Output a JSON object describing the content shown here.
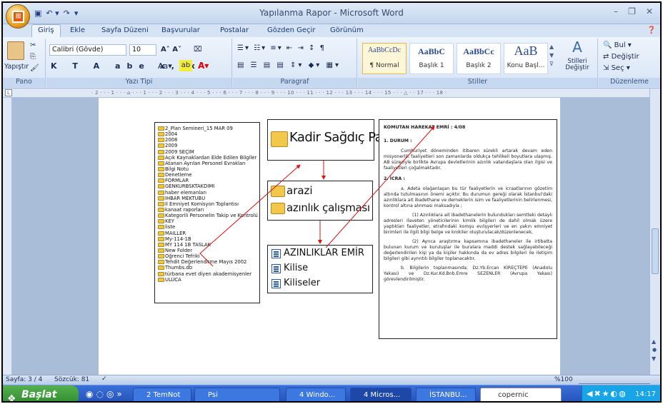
{
  "window": {
    "title": "Yapılanma Rapor - Microsoft Word"
  },
  "tabs": [
    "Giriş",
    "Ekle",
    "Sayfa Düzeni",
    "Başvurular",
    "Postalar",
    "Gözden Geçir",
    "Görünüm"
  ],
  "ribbon": {
    "clipboard": {
      "paste": "Yapıştır",
      "label": "Pano"
    },
    "font": {
      "name": "Calibri (Gövde)",
      "size": "10",
      "label": "Yazı Tipi"
    },
    "paragraph": {
      "label": "Paragraf"
    },
    "styles": {
      "label": "Stiller",
      "items": [
        {
          "sample": "AaBbCcDc",
          "name": "¶ Normal"
        },
        {
          "sample": "AaBbC",
          "name": "Başlık 1"
        },
        {
          "sample": "AaBbCc",
          "name": "Başlık 2"
        },
        {
          "sample": "AaB",
          "name": "Konu Başl..."
        }
      ],
      "change": "Stilleri Değiştir"
    },
    "editing": {
      "label": "Düzenleme",
      "find": "Bul",
      "replace": "Değiştir",
      "select": "Seç"
    }
  },
  "folder_list": [
    "2_Plan Semineri_15 MAR 09",
    "2004",
    "2008",
    "2009",
    "2009 SEÇİM",
    "Açık Kaynaklardan Elde Edilen Bilgiler",
    "Atanan Ayrılan Personel Evrakları",
    "Bilgi Notu",
    "Denetleme",
    "FORMLAR",
    "GENKURBSKTAKDİMİ",
    "haber elemanları",
    "İHBAR MEKTUBU",
    "İl Emniyet Komisyon Toplantısı",
    "kanaat raporları",
    "Kategorili Personelin Takip ve Kontrolü",
    "KEY",
    "liste",
    "MAILLER",
    "My-114-1B",
    "MY 114 1B TASLAK",
    "New Folder",
    "Öğrenci Tefriki",
    "Tehdit Değerlendirme Mayıs 2002",
    "Thumbs.db",
    "türbana evet diyen akademisyenler",
    "ULUCA"
  ],
  "box_kadir": "Kadir Sağdıç Paşa",
  "box_arazi": [
    "arazi",
    "azınlık çalışması"
  ],
  "box_docs": [
    "AZINLIKLAR EMİR",
    "Kilise",
    "Kiliseler"
  ],
  "doc": {
    "title": "KOMUTAN HAREKAT EMRİ : 4/08",
    "s1_head": "1.    DURUM       :",
    "s1_text": "Cumhuriyet döneminden itibaren sürekli artarak devam eden misyonerlik faaliyetleri son zamanlarda oldukça tehlikeli boyutlara ulaşmış. AB süreciyle birlikte Avrupa devletlerinin azınlık vatandaşlara olan ilgisi ve faaliyetleri çoğalmaktadır.",
    "s2_head": "2.    İCRA       :",
    "s2a": "a.    Adeta olağanlaşan bu tür faaliyetlerin ve icraatlarının gözetim altında tutulmasının önemi açıktır. Bu durumun gereği olarak İstanbul'daki azınliklara ait ibadethane ve derneklerin isim ve faaliyetlerinin belirlenmesi, kontrol altına alınması maksadıyla ;",
    "s2a1": "(1)    Azınlıklara ait ibadethanelerin bulundukları semtteki detaylı adresleri ilaveten yöneticilerinin kimlik bilgileri de dahil olmak üzere yaptıkları faaliyetler, etrafındaki komşu ev/işyerleri ve en yakın emniyet birimleri ile ilgili bilgi belge ve krokiler oluşturulacak/düzenlenecek,",
    "s2a2": "(2)    Ayrıca araştırma kapsamına ibadethaneler ile irtibatta bulunan kurum ve kuruluşlar ile buralara maddi destek sağlayabileceği değerlendirilen kişi ya da kişiler hakkında da ev adres bilgileri ile iletişim bilgileri gibi ayrıntılı bilgiler toplanacaktır.",
    "s2b": "b.    Bilgilerin toplanmasında; Dz.Yb.Ercan KİREÇTEPE (Anadolu Yakası) ve Dz.Kur.Kd.Bnb.Emre SEZENLER (Avrupa Yakası) görevlendirilmiştir."
  },
  "status": {
    "page": "Sayfa: 3 / 4",
    "words": "Sözcük: 81",
    "zoom": "%100"
  },
  "taskbar": {
    "start": "Başlat",
    "tasks": [
      "2 TemNot",
      "Psi",
      "4 Windo...",
      "4 Micros...",
      "İSTANBU...",
      "copernic"
    ],
    "clock": "14:17"
  }
}
